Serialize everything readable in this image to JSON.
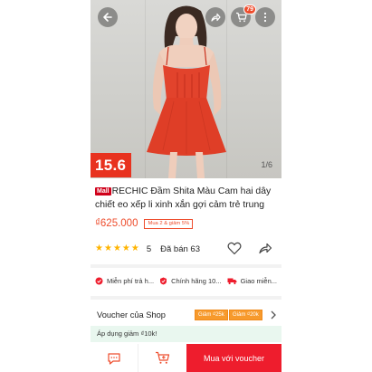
{
  "header": {
    "cart_count": "79",
    "image_position": "1/6"
  },
  "banner": {
    "date_tag": "15.6"
  },
  "product": {
    "mall_label": "Mall",
    "title": "RECHIC Đầm Shita Màu Cam hai dây chiết eo xếp li xinh xắn gợi cảm trẻ trung",
    "price": "₫625.000",
    "promo": "Mua 2 & giảm 5%",
    "rating": "5",
    "sold": "Đã bán 63",
    "star_count": 5
  },
  "services": [
    {
      "icon": "free-shipping-icon",
      "label": "Miễn phí trả h..."
    },
    {
      "icon": "authentic-icon",
      "label": "Chính hãng 10..."
    },
    {
      "icon": "delivery-truck-icon",
      "label": "Giao miễn..."
    }
  ],
  "vouchers": {
    "title": "Voucher của Shop",
    "chips": [
      "Giảm ₫25k",
      "Giảm ₫20k"
    ],
    "applied": "Áp dụng giảm ₫10k!"
  },
  "bottom": {
    "buy_label": "Mua với voucher"
  },
  "colors": {
    "accent": "#ee4d2d",
    "buy_button": "#ee1d2d",
    "date_tag": "#e8321f",
    "star": "#ffb400",
    "voucher_chip": "#f79a2c"
  }
}
